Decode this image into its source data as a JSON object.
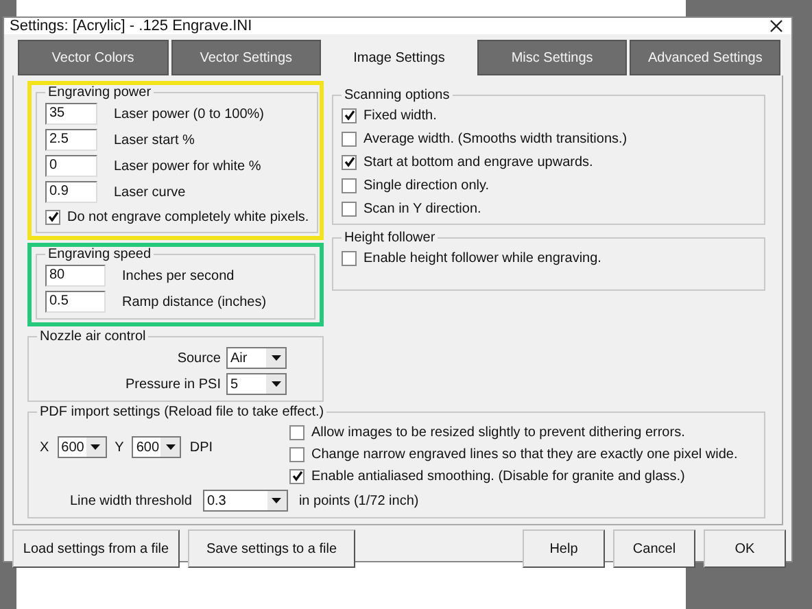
{
  "window": {
    "title": "Settings: [Acrylic] - .125 Engrave.INI"
  },
  "tabs": [
    {
      "label": "Vector Colors",
      "selected": false
    },
    {
      "label": "Vector Settings",
      "selected": false
    },
    {
      "label": "Image Settings",
      "selected": true
    },
    {
      "label": "Misc Settings",
      "selected": false
    },
    {
      "label": "Advanced Settings",
      "selected": false
    }
  ],
  "engraving_power": {
    "title": "Engraving power",
    "color": "#f2e31b",
    "fields": [
      {
        "value": "35",
        "label": "Laser power (0 to 100%)"
      },
      {
        "value": "2.5",
        "label": "Laser start %"
      },
      {
        "value": "0",
        "label": "Laser power for white %"
      },
      {
        "value": "0.9",
        "label": "Laser curve"
      }
    ],
    "checkbox": {
      "label": "Do not engrave completely white pixels.",
      "checked": true
    }
  },
  "engraving_speed": {
    "title": "Engraving speed",
    "color": "#25c97c",
    "fields": [
      {
        "value": "80",
        "label": "Inches per second"
      },
      {
        "value": "0.5",
        "label": "Ramp distance (inches)"
      }
    ]
  },
  "nozzle_air_control": {
    "title": "Nozzle air control",
    "dropdowns": [
      {
        "label": "Source",
        "value": "Air"
      },
      {
        "label": "Pressure in PSI",
        "value": "5"
      }
    ]
  },
  "scanning_options": {
    "title": "Scanning options",
    "options": [
      {
        "label": "Fixed width.",
        "checked": true
      },
      {
        "label": "Average width. (Smooths width transitions.)",
        "checked": false
      },
      {
        "label": "Start at bottom and engrave upwards.",
        "checked": true
      },
      {
        "label": "Single direction only.",
        "checked": false
      },
      {
        "label": "Scan in Y direction.",
        "checked": false
      }
    ]
  },
  "height_follower": {
    "title": "Height follower",
    "options": [
      {
        "label": "Enable height follower while engraving.",
        "checked": false
      }
    ]
  },
  "pdf_import": {
    "title": "PDF import settings (Reload file to take effect.)",
    "x_label": "X",
    "x_value": "600",
    "y_label": "Y",
    "y_value": "600",
    "unit": "DPI",
    "options": [
      {
        "label": "Allow images to be resized slightly to prevent dithering errors.",
        "checked": false
      },
      {
        "label": "Change narrow engraved lines so that they are exactly one pixel wide.",
        "checked": false
      },
      {
        "label": "Enable antialiased smoothing. (Disable for granite and glass.)",
        "checked": true
      }
    ],
    "threshold_label": "Line width threshold",
    "threshold_value": "0.3",
    "threshold_unit": "in points (1/72 inch)"
  },
  "buttons": [
    {
      "label": "Load settings from a file",
      "kind": "left"
    },
    {
      "label": "Save settings to a file",
      "kind": "left"
    },
    {
      "label": "Help",
      "kind": "right"
    },
    {
      "label": "Cancel",
      "kind": "right"
    },
    {
      "label": "OK",
      "kind": "right"
    }
  ]
}
